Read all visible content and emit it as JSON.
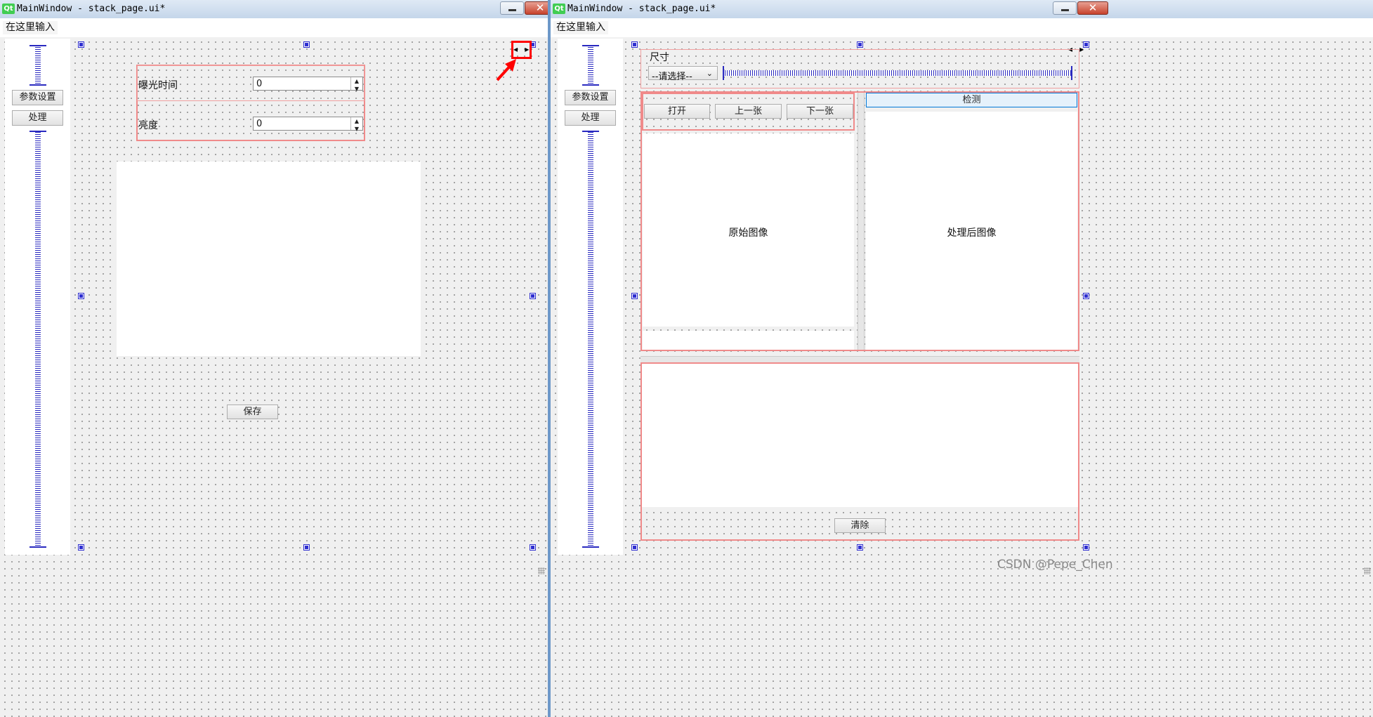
{
  "left_window": {
    "title": "MainWindow - stack_page.ui*",
    "qt_logo": "Qt",
    "menu_item": "在这里输入",
    "close_symbol": "✕",
    "sidebar": {
      "btn_params": "参数设置",
      "btn_process": "处理"
    },
    "exposure_label": "曝光时间",
    "exposure_value": "0",
    "brightness_label": "亮度",
    "brightness_value": "0",
    "save_button": "保存",
    "page_switch_glyph": "◂ ▸"
  },
  "right_window": {
    "title": "MainWindow - stack_page.ui*",
    "qt_logo": "Qt",
    "menu_item": "在这里输入",
    "close_symbol": "✕",
    "sidebar": {
      "btn_params": "参数设置",
      "btn_process": "处理"
    },
    "size_label": "尺寸",
    "combo_value": "--请选择--",
    "btn_open": "打开",
    "btn_prev": "上一张",
    "btn_next": "下一张",
    "btn_detect": "检测",
    "original_image_label": "原始图像",
    "processed_image_label": "处理后图像",
    "clear_button": "清除",
    "page_switch_glyph": "◂ ▸"
  },
  "watermark": "CSDN @Pepe_Chen",
  "annotation": {
    "color": "#ff0000"
  },
  "colors": {
    "spring": "#2a2ac0",
    "layout_box": "#f08a8a",
    "titlebar": "#c5d6ea",
    "close": "#c7432d"
  }
}
